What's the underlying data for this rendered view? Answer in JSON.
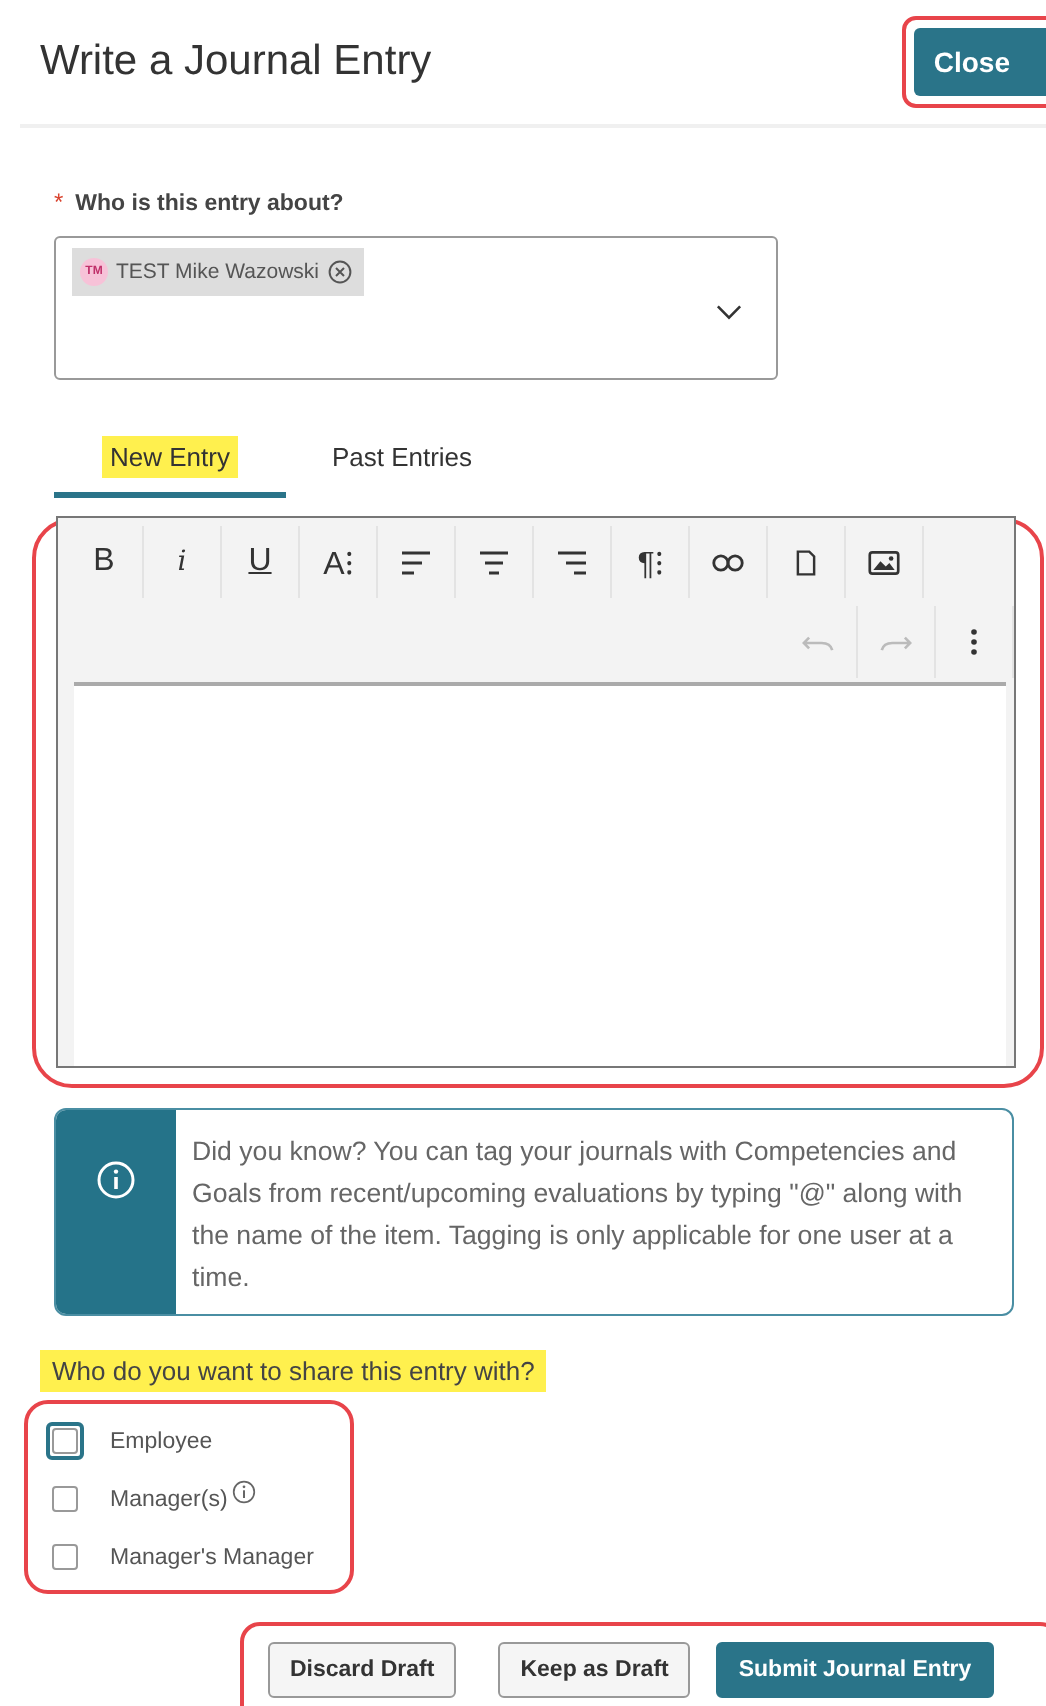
{
  "header": {
    "title": "Write a Journal Entry",
    "close_button": {
      "label": "Close",
      "outlined": true
    }
  },
  "subject": {
    "label": "Who is this entry about?",
    "required_mark": "*",
    "chips": [
      {
        "initials": "TM",
        "name": "TEST Mike Wazowski"
      }
    ]
  },
  "tabs": [
    {
      "label": "New Entry",
      "selected": true,
      "highlighted": true
    },
    {
      "label": "Past Entries",
      "selected": false,
      "highlighted": false
    }
  ],
  "editor": {
    "outlined": true,
    "toolbar_row_1": [
      {
        "kind": "bold",
        "label": "B"
      },
      {
        "kind": "italic",
        "label": "i"
      },
      {
        "kind": "underline",
        "label": "U"
      },
      {
        "kind": "font-size",
        "label": "A⁝"
      },
      {
        "kind": "align-left"
      },
      {
        "kind": "align-center"
      },
      {
        "kind": "align-right"
      },
      {
        "kind": "paragraph",
        "label": "¶⁝"
      },
      {
        "kind": "link"
      },
      {
        "kind": "file"
      },
      {
        "kind": "image"
      }
    ],
    "toolbar_row_2": [
      {
        "kind": "undo",
        "disabled": true
      },
      {
        "kind": "redo",
        "disabled": true
      },
      {
        "kind": "more",
        "disabled": false
      }
    ]
  },
  "info_box": {
    "text": "Did you know? You can tag your journals with Competencies and Goals from recent/upcoming evaluations by typing \"@\" along with the name of the item. Tagging is only applicable for one user at a time."
  },
  "share": {
    "label": "Who do you want to share this entry with?",
    "highlighted": true,
    "outlined": true,
    "options": [
      {
        "label": "Employee",
        "checked": false,
        "focused": true,
        "info": false
      },
      {
        "label": "Manager(s)",
        "checked": false,
        "focused": false,
        "info": true
      },
      {
        "label": "Manager's Manager",
        "checked": false,
        "focused": false,
        "info": false
      }
    ]
  },
  "footer": {
    "outlined": true,
    "buttons": [
      {
        "label": "Discard Draft",
        "kind": "secondary"
      },
      {
        "label": "Keep as Draft",
        "kind": "secondary"
      },
      {
        "label": "Submit Journal Entry",
        "kind": "primary"
      }
    ]
  }
}
